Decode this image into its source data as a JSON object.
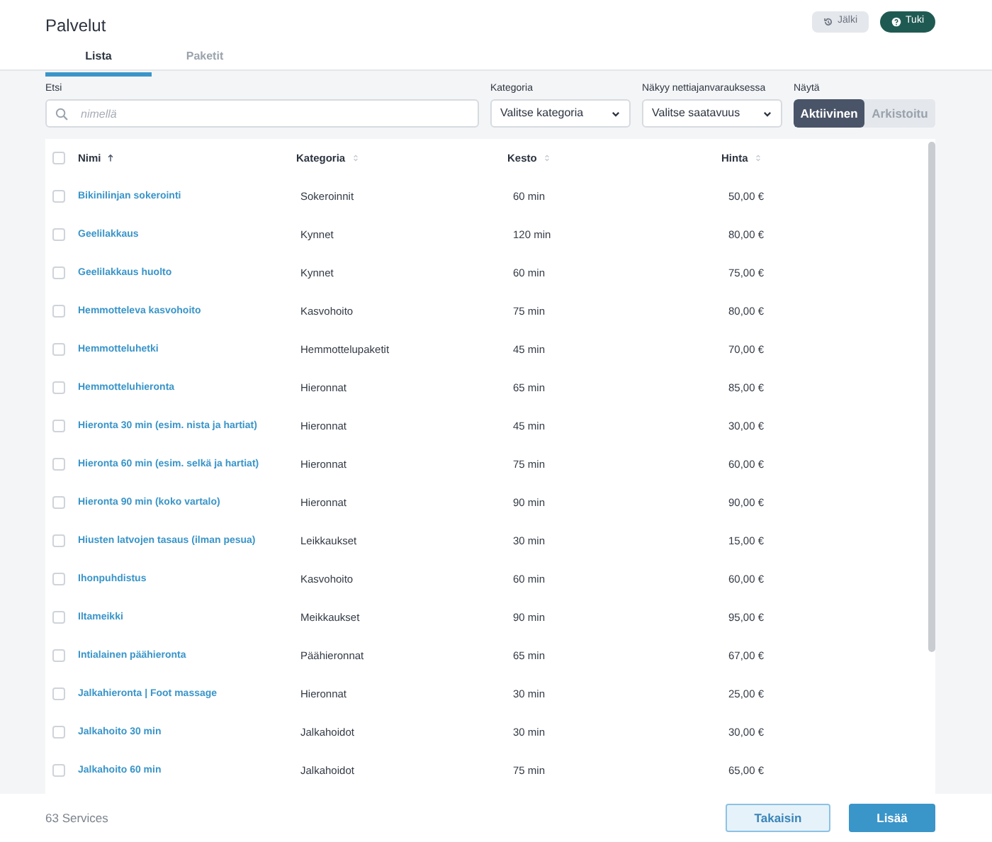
{
  "page_title": "Palvelut",
  "header_buttons": [
    {
      "kind": "history",
      "label": "Jälki"
    },
    {
      "kind": "help",
      "label": "Tuki"
    }
  ],
  "tabs": [
    {
      "label": "Lista",
      "selected": true
    },
    {
      "label": "Paketit",
      "selected": false
    }
  ],
  "filters": {
    "search": {
      "label": "Etsi",
      "placeholder": "nimellä"
    },
    "category": {
      "label": "Kategoria",
      "value": "Valitse kategoria"
    },
    "availability": {
      "label": "Näkyy nettiajanvarauksessa",
      "value": "Valitse saatavuus"
    },
    "show": {
      "label": "Näytä",
      "options": [
        {
          "label": "Aktiivinen",
          "selected": true
        },
        {
          "label": "Arkistoitu",
          "selected": false
        }
      ]
    }
  },
  "table": {
    "select_all_checked": false,
    "columns": [
      {
        "label": "Nimi",
        "sorted": true
      },
      {
        "label": "Kategoria",
        "sorted": false
      },
      {
        "label": "Kesto",
        "sorted": false
      },
      {
        "label": "Hinta",
        "sorted": false
      }
    ],
    "rows": [
      {
        "name": "Bikinilinjan sokerointi",
        "category": "Sokeroinnit",
        "duration": "60 min",
        "price": "50,00 €",
        "checked": false
      },
      {
        "name": "Geelilakkaus",
        "category": "Kynnet",
        "duration": "120 min",
        "price": "80,00 €",
        "checked": false
      },
      {
        "name": "Geelilakkaus huolto",
        "category": "Kynnet",
        "duration": "60 min",
        "price": "75,00 €",
        "checked": false
      },
      {
        "name": "Hemmotteleva kasvohoito",
        "category": "Kasvohoito",
        "duration": "75 min",
        "price": "80,00 €",
        "checked": false
      },
      {
        "name": "Hemmotteluhetki",
        "category": "Hemmottelupaketit",
        "duration": "45 min",
        "price": "70,00 €",
        "checked": false
      },
      {
        "name": "Hemmotteluhieronta",
        "category": "Hieronnat",
        "duration": "65 min",
        "price": "85,00 €",
        "checked": false
      },
      {
        "name": "Hieronta 30 min (esim. nista ja hartiat)",
        "category": "Hieronnat",
        "duration": "45 min",
        "price": "30,00 €",
        "checked": false
      },
      {
        "name": "Hieronta 60 min (esim. selkä ja hartiat)",
        "category": "Hieronnat",
        "duration": "75 min",
        "price": "60,00 €",
        "checked": false
      },
      {
        "name": "Hieronta 90 min (koko vartalo)",
        "category": "Hieronnat",
        "duration": "90 min",
        "price": "90,00 €",
        "checked": false
      },
      {
        "name": "Hiusten latvojen tasaus (ilman pesua)",
        "category": "Leikkaukset",
        "duration": "30 min",
        "price": "15,00 €",
        "checked": false
      },
      {
        "name": "Ihonpuhdistus",
        "category": "Kasvohoito",
        "duration": "60 min",
        "price": "60,00 €",
        "checked": false
      },
      {
        "name": "Iltameikki",
        "category": "Meikkaukset",
        "duration": "90 min",
        "price": "95,00 €",
        "checked": false
      },
      {
        "name": "Intialainen päähieronta",
        "category": "Päähieronnat",
        "duration": "65 min",
        "price": "67,00 €",
        "checked": false
      },
      {
        "name": "Jalkahieronta | Foot massage",
        "category": "Hieronnat",
        "duration": "30 min",
        "price": "25,00 €",
        "checked": false
      },
      {
        "name": "Jalkahoito 30 min",
        "category": "Jalkahoidot",
        "duration": "30 min",
        "price": "30,00 €",
        "checked": false
      },
      {
        "name": "Jalkahoito 60 min",
        "category": "Jalkahoidot",
        "duration": "75 min",
        "price": "65,00 €",
        "checked": false
      }
    ]
  },
  "footer": {
    "count": "63 Services",
    "buttons": [
      {
        "kind": "secondary",
        "label": "Takaisin"
      },
      {
        "kind": "primary",
        "label": "Lisää"
      }
    ]
  }
}
